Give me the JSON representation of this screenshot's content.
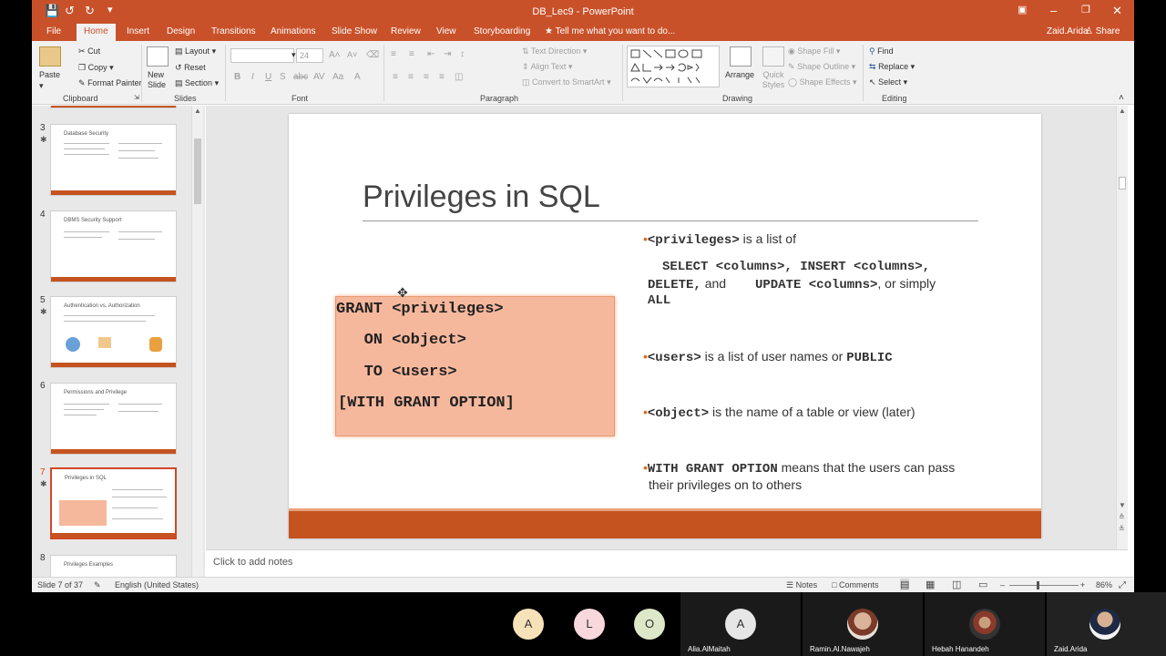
{
  "window": {
    "title": "DB_Lec9  -  PowerPoint",
    "user": "Zaid.Arida",
    "share": "Share",
    "tell_me": "Tell me what you want to do..."
  },
  "tabs": [
    "File",
    "Home",
    "Insert",
    "Design",
    "Transitions",
    "Animations",
    "Slide Show",
    "Review",
    "View",
    "Storyboarding"
  ],
  "ribbon": {
    "clipboard": {
      "label": "Clipboard",
      "paste": "Paste",
      "cut": "Cut",
      "copy": "Copy",
      "format_painter": "Format Painter"
    },
    "slides": {
      "label": "Slides",
      "new_slide": "New Slide",
      "layout": "Layout",
      "reset": "Reset",
      "section": "Section"
    },
    "font": {
      "label": "Font",
      "size": "24"
    },
    "paragraph": {
      "label": "Paragraph",
      "text_direction": "Text Direction",
      "align_text": "Align Text",
      "convert_smartart": "Convert to SmartArt"
    },
    "drawing": {
      "label": "Drawing",
      "arrange": "Arrange",
      "quick_styles": "Quick Styles",
      "shape_fill": "Shape Fill",
      "shape_outline": "Shape Outline",
      "shape_effects": "Shape Effects"
    },
    "editing": {
      "label": "Editing",
      "find": "Find",
      "replace": "Replace",
      "select": "Select"
    }
  },
  "thumbnails": [
    {
      "num": "3",
      "title": "Database Security"
    },
    {
      "num": "4",
      "title": "DBMS Security Support"
    },
    {
      "num": "5",
      "title": "Authentication vs. Authorization"
    },
    {
      "num": "6",
      "title": "Permissions and Privilege"
    },
    {
      "num": "7",
      "title": "Privileges in SQL"
    },
    {
      "num": "8",
      "title": "Privileges Examples"
    }
  ],
  "slide": {
    "title": "Privileges in SQL",
    "code": [
      "GRANT <privileges>",
      "   ON <object>",
      "   TO <users>",
      "[WITH GRANT OPTION]"
    ],
    "b1_code": "<privileges>",
    "b1_text": " is a list of",
    "b1_l2": "SELECT <columns>, INSERT <columns>,",
    "b1_l3a": "DELETE,",
    "b1_l3b": " and ",
    "b1_l3c": "UPDATE <columns>",
    "b1_l3d": ", or simply",
    "b1_l4": "ALL",
    "b2_code": "<users>",
    "b2_text": " is a list of user names or ",
    "b2_code2": "PUBLIC",
    "b3_code": "<object>",
    "b3_text": " is the name of a table or view (later)",
    "b4_code": "WITH GRANT OPTION",
    "b4_text": " means that the users can pass",
    "b4_text2": "their privileges on to others"
  },
  "notes_placeholder": "Click to add notes",
  "status": {
    "slide": "Slide 7 of 37",
    "language": "English (United States)",
    "notes": "Notes",
    "comments": "Comments",
    "zoom": "86%"
  },
  "participants": [
    {
      "initial": "A",
      "color": "#f6e2b8"
    },
    {
      "initial": "L",
      "color": "#f8d8dc"
    },
    {
      "initial": "O",
      "color": "#dde8c8"
    },
    {
      "initial": "A",
      "color": "#e6e6e6",
      "name": "Alia.AlMaitah"
    },
    {
      "name": "Ramin.Al.Nawajeh"
    },
    {
      "name": "Hebah Hanandeh"
    },
    {
      "name": "Zaid.Arida"
    }
  ]
}
